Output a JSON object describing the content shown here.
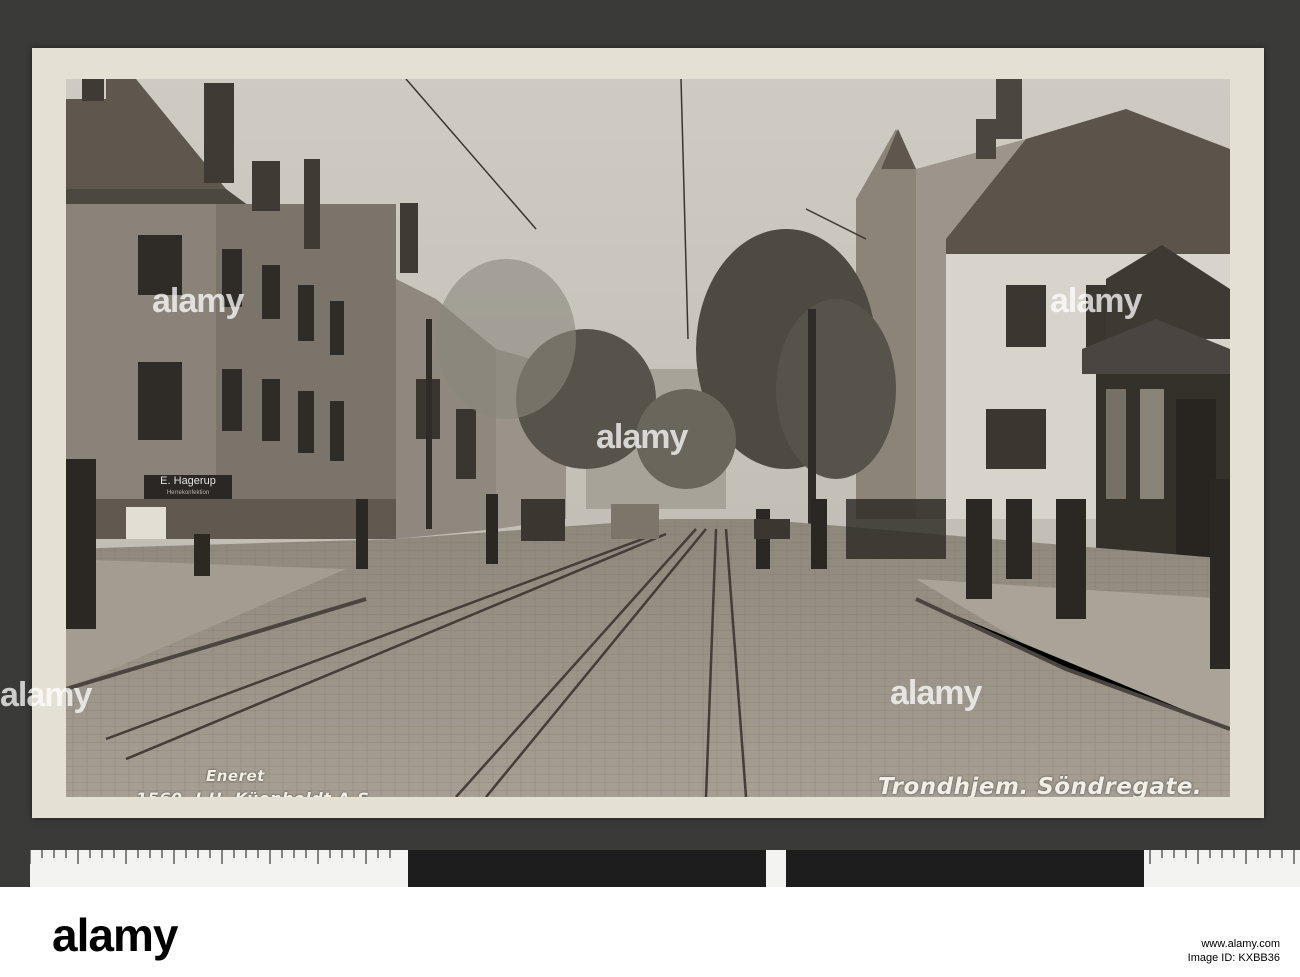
{
  "postcard": {
    "title_caption": "Trondhjem. Söndregate.",
    "eneret": "Eneret",
    "publisher": "1560. J.H. Küenholdt A.S.",
    "shop_sign": "E. Hagerup",
    "shop_sign_sub": "Herrekonfektion"
  },
  "watermarks": {
    "label": "alamy"
  },
  "footer": {
    "logo": "alamy",
    "url": "www.alamy.com",
    "image_id": "Image ID: KXBB36"
  }
}
